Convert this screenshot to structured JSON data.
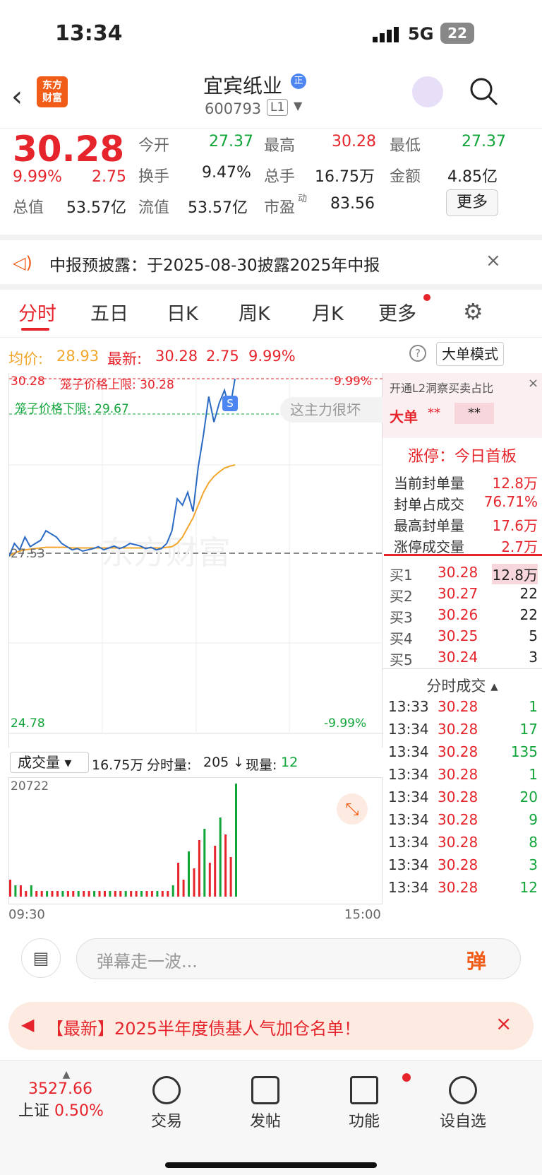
{
  "status": {
    "time": "13:34",
    "network": "5G",
    "battery": "22"
  },
  "nav": {
    "title": "宜宾纸业",
    "code": "600793",
    "level": "L1",
    "logo_line1": "东方",
    "logo_line2": "财富"
  },
  "quote": {
    "price": "30.28",
    "pct": "9.99%",
    "chg": "2.75",
    "open_label": "今开",
    "open": "27.37",
    "high_label": "最高",
    "high": "30.28",
    "low_label": "最低",
    "low": "27.37",
    "turnover_label": "换手",
    "turnover": "9.47%",
    "volume_label": "总手",
    "volume": "16.75万",
    "amount_label": "金额",
    "amount": "4.85亿",
    "mktcap_label": "总值",
    "mktcap": "53.57亿",
    "float_label": "流值",
    "float": "53.57亿",
    "pe_label": "市盈",
    "pe_sup": "动",
    "pe": "83.56",
    "more": "更多"
  },
  "notice": {
    "text": "中报预披露：于2025-08-30披露2025年中报"
  },
  "tabs": [
    "分时",
    "五日",
    "日K",
    "周K",
    "月K",
    "更多"
  ],
  "info": {
    "avg_label": "均价:",
    "avg": "28.93",
    "last_label": "最新:",
    "last": "30.28",
    "chg": "2.75",
    "pct": "9.99%",
    "mode_btn": "大单模式"
  },
  "chart_data": {
    "type": "line",
    "title": "",
    "ylim": [
      24.78,
      30.28
    ],
    "yleft_top": "30.28",
    "yleft_mid": "27.53",
    "yleft_bot": "24.78",
    "yright_top": "9.99%",
    "yright_bot": "-9.99%",
    "cage_upper": "笼子价格上限: 30.28",
    "cage_lower": "笼子价格下限: 29.67",
    "watermark": "东方财富",
    "bubble": "这主力很坏",
    "x_start": "09:30",
    "x_end": "15:00",
    "series": [
      {
        "values": [
          27.5,
          27.7,
          27.6,
          27.8,
          27.65,
          27.7,
          27.75,
          27.9,
          27.85,
          27.8,
          27.7,
          27.65,
          27.6,
          27.62,
          27.58,
          27.6,
          27.62,
          27.65,
          27.6,
          27.63,
          27.66,
          27.62,
          27.65,
          27.7,
          27.68,
          27.66,
          27.62,
          27.64,
          27.6,
          27.62,
          27.7,
          27.9,
          28.4,
          28.3,
          28.5,
          28.2,
          28.9,
          29.4,
          30.0,
          29.6,
          29.9,
          30.1,
          29.8,
          30.28
        ]
      },
      {
        "values": [
          27.5,
          27.55,
          27.58,
          27.6,
          27.61,
          27.62,
          27.63,
          27.64,
          27.64,
          27.64,
          27.64,
          27.64,
          27.63,
          27.63,
          27.63,
          27.63,
          27.63,
          27.63,
          27.63,
          27.63,
          27.63,
          27.63,
          27.63,
          27.63,
          27.63,
          27.63,
          27.63,
          27.63,
          27.63,
          27.63,
          27.64,
          27.65,
          27.7,
          27.8,
          27.95,
          28.1,
          28.3,
          28.5,
          28.65,
          28.75,
          28.82,
          28.88,
          28.91,
          28.93
        ]
      }
    ]
  },
  "volume": {
    "label": "成交量",
    "total": "16.75万",
    "tick_label": "分时量:",
    "tick": "205",
    "now_label": "现量:",
    "now": "12",
    "max": "20722",
    "bars": [
      3,
      2,
      2,
      1,
      2,
      1,
      1,
      1,
      1,
      1,
      1,
      1,
      1,
      1,
      1,
      1,
      1,
      1,
      1,
      1,
      1,
      1,
      1,
      1,
      1,
      1,
      1,
      1,
      1,
      1,
      1,
      2,
      6,
      3,
      8,
      5,
      10,
      12,
      6,
      9,
      14,
      11,
      7,
      20
    ]
  },
  "side": {
    "l2_title": "开通L2洞察买卖占比",
    "big_label": "大单",
    "big_val": "**",
    "zt_title": "涨停：今日首板",
    "rows": [
      {
        "k": "当前封单量",
        "v": "12.8万"
      },
      {
        "k": "封单占成交",
        "v": "76.71%"
      },
      {
        "k": "最高封单量",
        "v": "17.6万"
      },
      {
        "k": "涨停成交量",
        "v": "2.7万"
      }
    ],
    "bids": [
      {
        "k": "买1",
        "p": "30.28",
        "v": "12.8万"
      },
      {
        "k": "买2",
        "p": "30.27",
        "v": "22"
      },
      {
        "k": "买3",
        "p": "30.26",
        "v": "22"
      },
      {
        "k": "买4",
        "p": "30.25",
        "v": "5"
      },
      {
        "k": "买5",
        "p": "30.24",
        "v": "3"
      }
    ],
    "ticks_title": "分时成交",
    "ticks": [
      {
        "t": "13:33",
        "p": "30.28",
        "v": "1"
      },
      {
        "t": "13:34",
        "p": "30.28",
        "v": "17"
      },
      {
        "t": "13:34",
        "p": "30.28",
        "v": "135"
      },
      {
        "t": "13:34",
        "p": "30.28",
        "v": "1"
      },
      {
        "t": "13:34",
        "p": "30.28",
        "v": "20"
      },
      {
        "t": "13:34",
        "p": "30.28",
        "v": "9"
      },
      {
        "t": "13:34",
        "p": "30.28",
        "v": "8"
      },
      {
        "t": "13:34",
        "p": "30.28",
        "v": "3"
      },
      {
        "t": "13:34",
        "p": "30.28",
        "v": "12"
      }
    ]
  },
  "comment": {
    "placeholder": "弹幕走一波...",
    "btn": "弹"
  },
  "banner": {
    "text": "【最新】2025半年度债基人气加仓名单！"
  },
  "bottom": {
    "index_val": "3527.66",
    "index_name": "上证",
    "index_pct": "0.50%",
    "items": [
      "交易",
      "发帖",
      "功能",
      "设自选"
    ]
  }
}
